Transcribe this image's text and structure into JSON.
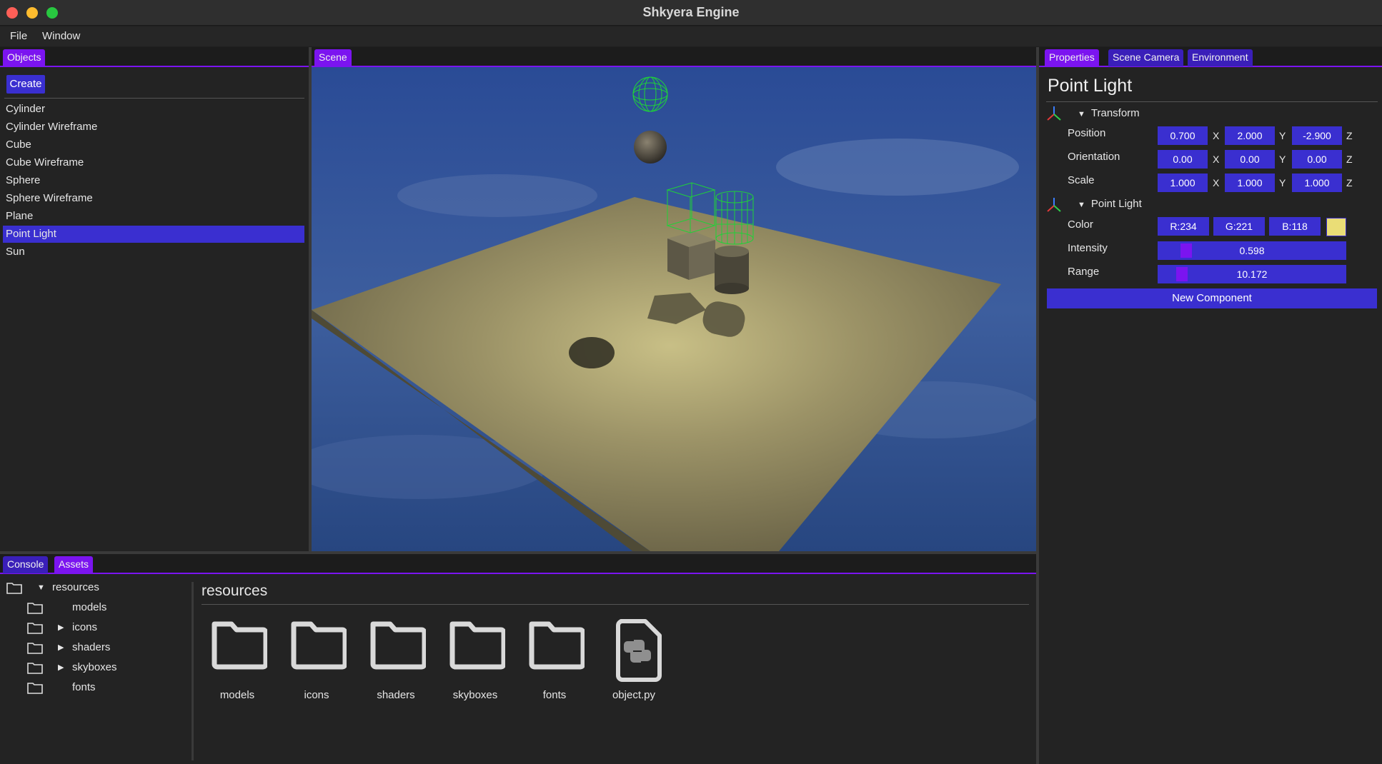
{
  "window": {
    "title": "Shkyera Engine"
  },
  "menu": {
    "items": [
      "File",
      "Window"
    ]
  },
  "objects_panel": {
    "tab": "Objects",
    "create_label": "Create",
    "items": [
      "Cylinder",
      "Cylinder Wireframe",
      "Cube",
      "Cube Wireframe",
      "Sphere",
      "Sphere Wireframe",
      "Plane",
      "Point Light",
      "Sun"
    ],
    "selected": "Point Light"
  },
  "scene_panel": {
    "tab": "Scene"
  },
  "properties_panel": {
    "tabs": [
      "Properties",
      "Scene Camera",
      "Environment"
    ],
    "object_name": "Point Light",
    "transform": {
      "header": "Transform",
      "position_label": "Position",
      "position": [
        "0.700",
        "2.000",
        "-2.900"
      ],
      "orientation_label": "Orientation",
      "orientation": [
        "0.00",
        "0.00",
        "0.00"
      ],
      "scale_label": "Scale",
      "scale": [
        "1.000",
        "1.000",
        "1.000"
      ],
      "axes": [
        "X",
        "Y",
        "Z"
      ]
    },
    "point_light": {
      "header": "Point Light",
      "color_label": "Color",
      "color_r": "R:234",
      "color_g": "G:221",
      "color_b": "B:118",
      "color_hex": "#eadd76",
      "intensity_label": "Intensity",
      "intensity": "0.598",
      "range_label": "Range",
      "range": "10.172"
    },
    "new_component_label": "New Component"
  },
  "bottom_panel": {
    "tabs": [
      "Console",
      "Assets"
    ],
    "active_tab": "Assets",
    "tree": [
      {
        "label": "resources",
        "expanded": true
      },
      {
        "label": "models",
        "expandable": false
      },
      {
        "label": "icons",
        "expandable": true
      },
      {
        "label": "shaders",
        "expandable": true
      },
      {
        "label": "skyboxes",
        "expandable": true
      },
      {
        "label": "fonts",
        "expandable": false
      }
    ],
    "current_folder": "resources",
    "tiles": [
      {
        "label": "models",
        "icon": "folder-icon"
      },
      {
        "label": "icons",
        "icon": "folder-icon"
      },
      {
        "label": "shaders",
        "icon": "folder-icon"
      },
      {
        "label": "skyboxes",
        "icon": "folder-icon"
      },
      {
        "label": "fonts",
        "icon": "folder-icon"
      },
      {
        "label": "object.py",
        "icon": "python-file-icon"
      }
    ]
  },
  "colors": {
    "accent": "#7b14f0",
    "field": "#3a2fd0"
  }
}
